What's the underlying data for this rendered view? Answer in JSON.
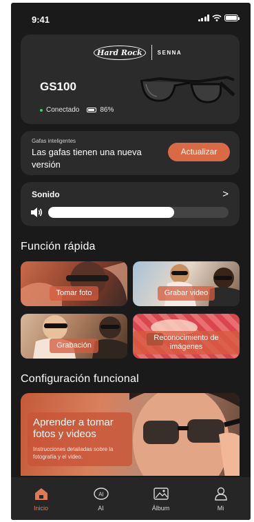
{
  "status_bar": {
    "time": "9:41",
    "icons": [
      "signal-icon",
      "wifi-icon",
      "battery-icon"
    ]
  },
  "device": {
    "brand_left": "Hard Rock",
    "brand_right": "SENNA",
    "model": "GS100",
    "connection": "Conectado",
    "battery": "86%",
    "battery_level": 0.86,
    "connection_color": "#3bd16f"
  },
  "update": {
    "caption": "Gafas inteligentes",
    "message": "Las gafas tienen una nueva versión",
    "button": "Actualizar",
    "accent": "#d96a44"
  },
  "sound": {
    "title": "Sonido",
    "volume": 0.7
  },
  "quick": {
    "title": "Función rápida",
    "tiles": [
      {
        "label": "Tomar foto"
      },
      {
        "label": "Grabar video"
      },
      {
        "label": "Grabación"
      },
      {
        "label": "Reconocimiento de imágenes"
      }
    ]
  },
  "config": {
    "title": "Configuración funcional",
    "banner_title": "Aprender a tomar fotos y videos",
    "banner_desc": "Instrucciones detalladas sobre la fotografía y el video."
  },
  "nav": [
    {
      "label": "Inicio",
      "icon": "home-icon",
      "active": true
    },
    {
      "label": "AI",
      "icon": "ai-icon",
      "active": false
    },
    {
      "label": "Álbum",
      "icon": "album-icon",
      "active": false
    },
    {
      "label": "Mi",
      "icon": "user-icon",
      "active": false
    }
  ]
}
